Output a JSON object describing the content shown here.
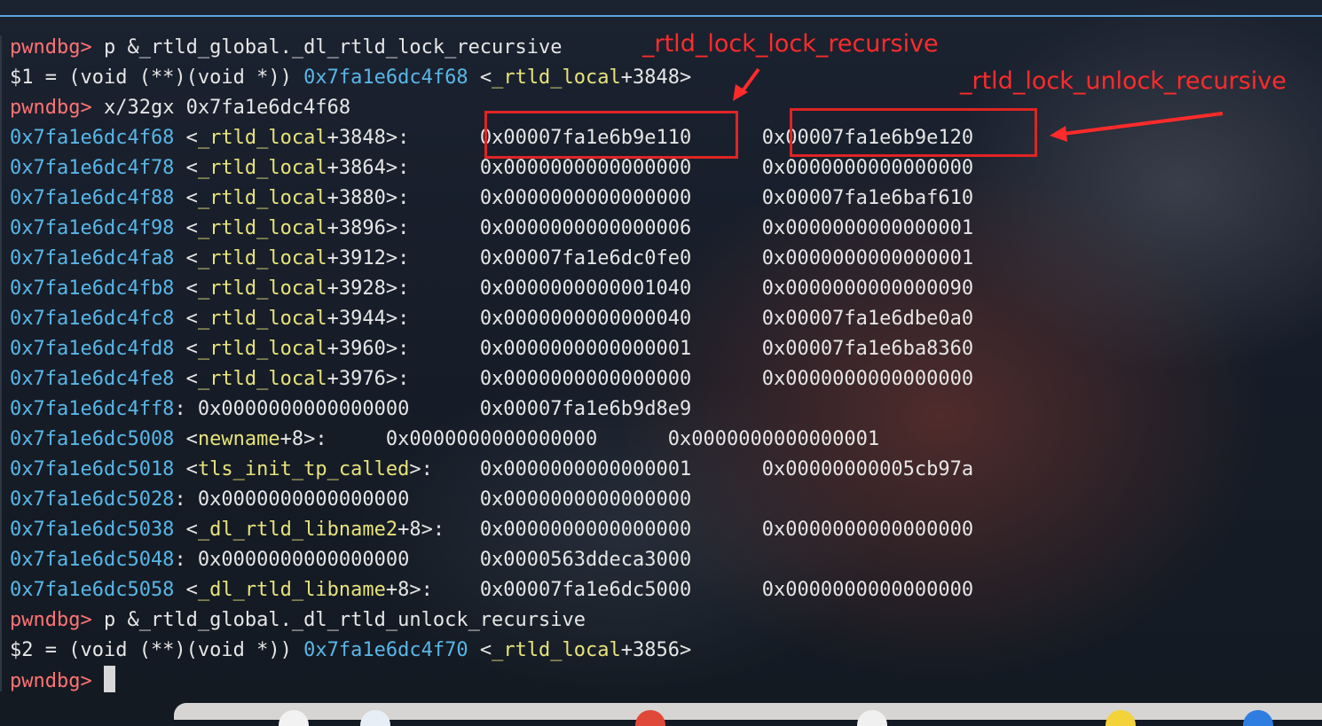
{
  "terminal": {
    "lines": [
      {
        "prompt": "pwndbg>",
        "cmd": " p &_rtld_global._dl_rtld_lock_recursive"
      },
      {
        "pre": "$1 = (void (**)(void *)) ",
        "addr": "0x7fa1e6dc4f68",
        "mid": " <",
        "sym": "_rtld_local",
        "post": "+3848>"
      },
      {
        "prompt": "pwndbg>",
        "cmd": " x/32gx 0x7fa1e6dc4f68"
      },
      {
        "addr": "0x7fa1e6dc4f68",
        "mid": " <",
        "sym": "_rtld_local",
        "post": "+3848>:      0x00007fa1e6b9e110      0x00007fa1e6b9e120"
      },
      {
        "addr": "0x7fa1e6dc4f78",
        "mid": " <",
        "sym": "_rtld_local",
        "post": "+3864>:      0x0000000000000000      0x0000000000000000"
      },
      {
        "addr": "0x7fa1e6dc4f88",
        "mid": " <",
        "sym": "_rtld_local",
        "post": "+3880>:      0x0000000000000000      0x00007fa1e6baf610"
      },
      {
        "addr": "0x7fa1e6dc4f98",
        "mid": " <",
        "sym": "_rtld_local",
        "post": "+3896>:      0x0000000000000006      0x0000000000000001"
      },
      {
        "addr": "0x7fa1e6dc4fa8",
        "mid": " <",
        "sym": "_rtld_local",
        "post": "+3912>:      0x00007fa1e6dc0fe0      0x0000000000000001"
      },
      {
        "addr": "0x7fa1e6dc4fb8",
        "mid": " <",
        "sym": "_rtld_local",
        "post": "+3928>:      0x0000000000001040      0x0000000000000090"
      },
      {
        "addr": "0x7fa1e6dc4fc8",
        "mid": " <",
        "sym": "_rtld_local",
        "post": "+3944>:      0x0000000000000040      0x00007fa1e6dbe0a0"
      },
      {
        "addr": "0x7fa1e6dc4fd8",
        "mid": " <",
        "sym": "_rtld_local",
        "post": "+3960>:      0x0000000000000001      0x00007fa1e6ba8360"
      },
      {
        "addr": "0x7fa1e6dc4fe8",
        "mid": " <",
        "sym": "_rtld_local",
        "post": "+3976>:      0x0000000000000000      0x0000000000000000"
      },
      {
        "addr": "0x7fa1e6dc4ff8",
        "post": ": 0x0000000000000000      0x00007fa1e6b9d8e9"
      },
      {
        "addr": "0x7fa1e6dc5008",
        "mid": " <",
        "sym": "newname",
        "post": "+8>:     0x0000000000000000      0x0000000000000001"
      },
      {
        "addr": "0x7fa1e6dc5018",
        "mid": " <",
        "sym": "tls_init_tp_called",
        "post": ">:    0x0000000000000001      0x00000000005cb97a"
      },
      {
        "addr": "0x7fa1e6dc5028",
        "post": ": 0x0000000000000000      0x0000000000000000"
      },
      {
        "addr": "0x7fa1e6dc5038",
        "mid": " <",
        "sym": "_dl_rtld_libname2",
        "post": "+8>:   0x0000000000000000      0x0000000000000000"
      },
      {
        "addr": "0x7fa1e6dc5048",
        "post": ": 0x0000000000000000      0x0000563ddeca3000"
      },
      {
        "addr": "0x7fa1e6dc5058",
        "mid": " <",
        "sym": "_dl_rtld_libname",
        "post": "+8>:    0x00007fa1e6dc5000      0x0000000000000000"
      },
      {
        "prompt": "pwndbg>",
        "cmd": " p &_rtld_global._dl_rtld_unlock_recursive"
      },
      {
        "pre": "$2 = (void (**)(void *)) ",
        "addr": "0x7fa1e6dc4f70",
        "mid": " <",
        "sym": "_rtld_local",
        "post": "+3856>"
      },
      {
        "prompt": "pwndbg>",
        "cmd": " "
      }
    ]
  },
  "annotations": {
    "lock_label": "_rtld_lock_lock_recursive",
    "unlock_label": "_rtld_lock_unlock_recursive",
    "color": "#ff2b2b"
  },
  "colors": {
    "prompt": "#ff7373",
    "address": "#58b7e8",
    "symbol": "#e8e37a",
    "text": "#e6e6e6"
  }
}
